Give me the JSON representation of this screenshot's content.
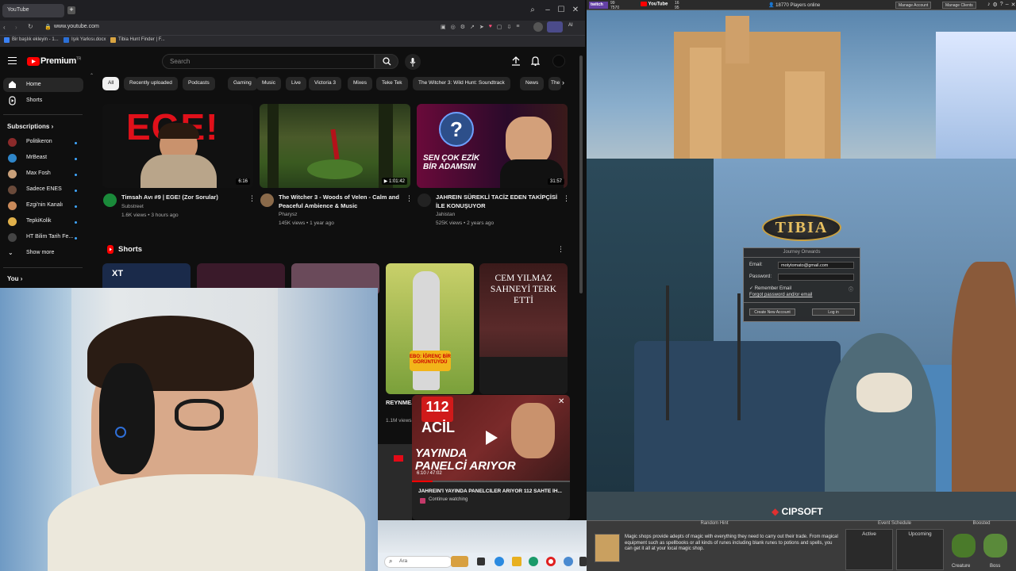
{
  "browser": {
    "tab_title": "YouTube",
    "url": "www.youtube.com",
    "bookmarks": [
      "Bir başlık ekleyin - 1...",
      "Işık Yarkısı.docx",
      "Tibia Hunt Finder | F..."
    ]
  },
  "youtube": {
    "logo_text": "Premium",
    "logo_superscript": "TR",
    "search_placeholder": "Search",
    "sidebar": {
      "home": "Home",
      "shorts": "Shorts",
      "subscriptions_title": "Subscriptions",
      "subscriptions": [
        {
          "name": "Politikeron",
          "color": "#8b2a2a"
        },
        {
          "name": "MrBeast",
          "color": "#2f86c9"
        },
        {
          "name": "Max Fosh",
          "color": "#c9a07a"
        },
        {
          "name": "Sadece ENES",
          "color": "#6a4a3a"
        },
        {
          "name": "Ezgi'nin Kanalı",
          "color": "#c98a5a"
        },
        {
          "name": "TepkiKolik",
          "color": "#e0b04a"
        },
        {
          "name": "HT Bilim Tarih Fe...",
          "color": "#444444"
        }
      ],
      "show_more": "Show more",
      "you": "You"
    },
    "chips": [
      "All",
      "Recently uploaded",
      "Podcasts",
      "Gaming",
      "Music",
      "Live",
      "Victoria 3",
      "Mixes",
      "Teke Tek",
      "The Witcher 3: Wild Hunt: Soundtrack",
      "News",
      "The"
    ],
    "videos": [
      {
        "title": "Timsah Avı #9 | EGE! (Zor Sorular)",
        "channel": "Substreet",
        "meta": "1.6K views • 3 hours ago",
        "duration": "6:16",
        "thumb_text": "EGE!"
      },
      {
        "title": "The Witcher 3 - Woods of Velen - Calm and Peaceful Ambience & Music",
        "channel": "Pharysz",
        "meta": "145K views • 1 year ago",
        "duration": "1:01:42"
      },
      {
        "title": "JAHREIN SÜREKLİ TACİZ EDEN TAKİPÇİSİ İLE KONUŞUYOR",
        "channel": "Jahistan",
        "meta": "525K views • 2 years ago",
        "duration": "31:57",
        "thumb_text": "SEN ÇOK EZİK BİR ADAMSIN"
      }
    ],
    "shorts_title": "Shorts",
    "shorts": [
      {
        "thumb_text": "EBO: İĞRENÇ BİR GÖRÜNTÜYDÜ",
        "title": "REYNME... SAHNE K...",
        "meta": "1.1M views"
      },
      {
        "thumb_text": "CEM YILMAZ SAHNEYİ TERK ETTİ"
      }
    ],
    "miniplayer": {
      "title": "JAHREİN'İ YAYINDA PANELCİLER ARIYOR 112 SAHTE İH...",
      "continue": "Continue watching",
      "time": "6:10 / 47:02",
      "thumb_text": "YAYINDA PANELCİ ARIYOR",
      "badge": "112 ACİL"
    }
  },
  "taskbar": {
    "search_placeholder": "Ara"
  },
  "game": {
    "twitch_viewers": "99",
    "twitch_followers": "7570",
    "youtube_viewers": "16",
    "youtube_subs": "95",
    "players_online": "18770 Players online",
    "manage_account": "Manage Account",
    "manage_clients": "Manage Clients",
    "logo": "TIBIA",
    "login": {
      "title": "Journey Onwards",
      "email_label": "Email:",
      "email_value": "motytomato@gmail.com",
      "password_label": "Password:",
      "remember": "Remember Email",
      "forgot": "Forgot password and/or email",
      "create": "Create New Account",
      "login": "Log in"
    },
    "cipsoft": "CIPSOFT",
    "random_hint_title": "Random Hint",
    "random_hint": "Magic shops provide adepts of magic with everything they need to carry out their trade. From magical equipment such as spellbooks or all kinds of runes including blank runes to potions and spells, you can get it all at your local magic shop.",
    "event_schedule": "Event Schedule",
    "active": "Active",
    "upcoming": "Upcoming",
    "boosted": "Boosted",
    "creature": "Creature",
    "boss": "Boss"
  }
}
